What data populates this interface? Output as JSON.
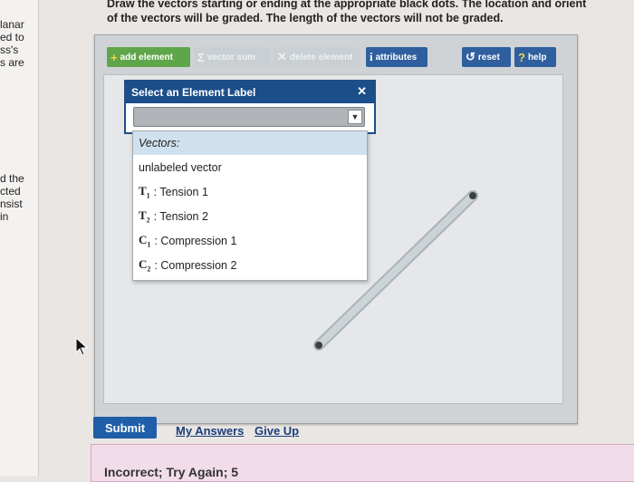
{
  "left_panel": {
    "fragments": [
      "lanar",
      "ed to",
      "ss's",
      "s are",
      "d the",
      "cted",
      "nsist",
      "in"
    ]
  },
  "instructions": {
    "line1": "Draw the vectors starting or ending at the appropriate black dots. The location and orient",
    "line2": "of the vectors will be graded. The length of the vectors will not be graded."
  },
  "toolbar": {
    "add_element": "add element",
    "vector_sum": "vector sum",
    "delete_element": "delete element",
    "attributes": "attributes",
    "reset": "reset",
    "help": "help"
  },
  "modal": {
    "title": "Select an Element Label",
    "close": "✕",
    "select_value": ""
  },
  "dropdown": {
    "header": "Vectors:",
    "items": [
      {
        "symbol": "",
        "sub": "",
        "label": "unlabeled vector"
      },
      {
        "symbol": "T",
        "sub": "1",
        "label": ": Tension 1"
      },
      {
        "symbol": "T",
        "sub": "2",
        "label": ": Tension 2"
      },
      {
        "symbol": "C",
        "sub": "1",
        "label": ": Compression 1"
      },
      {
        "symbol": "C",
        "sub": "2",
        "label": ": Compression 2"
      }
    ]
  },
  "actions": {
    "submit": "Submit",
    "my_answers": "My Answers",
    "give_up": "Give Up"
  },
  "result": {
    "text": "Incorrect; Try Again; 5"
  },
  "colors": {
    "toolbar_green": "#5fa64a",
    "toolbar_disabled": "#c9cfd3",
    "toolbar_blue": "#2f5f9e",
    "modal_blue": "#1c4e8a",
    "submit_blue": "#1f5ea8"
  }
}
